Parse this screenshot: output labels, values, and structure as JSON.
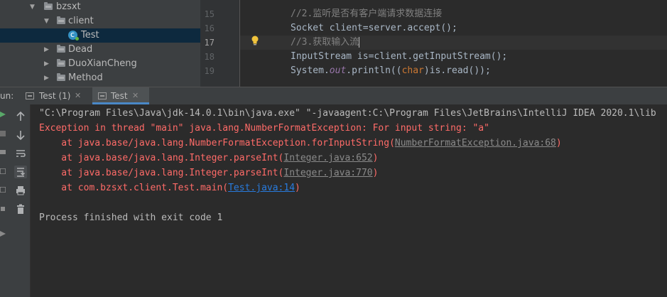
{
  "project_tree": {
    "items": [
      {
        "label": "bzsxt",
        "type": "package",
        "expanded": true
      },
      {
        "label": "client",
        "type": "package",
        "expanded": true
      },
      {
        "label": "Test",
        "type": "class",
        "selected": true
      },
      {
        "label": "Dead",
        "type": "package",
        "expanded": false
      },
      {
        "label": "DuoXianCheng",
        "type": "package",
        "expanded": false
      },
      {
        "label": "Method",
        "type": "package",
        "expanded": false
      }
    ]
  },
  "editor": {
    "line_numbers": [
      "15",
      "16",
      "17",
      "18",
      "19"
    ],
    "current_line": "17",
    "lines": {
      "l15": "//2.监听是否有客户端请求数据连接",
      "l16": "Socket client=server.accept();",
      "l17": "//3.获取输入流",
      "l18": "InputStream is=client.getInputStream();",
      "l19a": "System.",
      "l19b": "out",
      "l19c": ".println((",
      "l19d": "char",
      "l19e": ")is.read());"
    }
  },
  "run_window": {
    "label": "un:",
    "tabs": [
      {
        "label": "Test (1)",
        "active": false
      },
      {
        "label": "Test",
        "active": true
      }
    ],
    "toolbar_icons": [
      "run-icon",
      "up-arrow-icon",
      "down-arrow-icon",
      "soft-wrap-icon",
      "scroll-to-end-icon",
      "print-icon",
      "trash-icon"
    ]
  },
  "console": {
    "command": "\"C:\\Program Files\\Java\\jdk-14.0.1\\bin\\java.exe\" \"-javaagent:C:\\Program Files\\JetBrains\\IntelliJ IDEA 2020.1\\lib",
    "exception": "Exception in thread \"main\" java.lang.NumberFormatException: For input string: \"a\"",
    "stack": [
      {
        "prefix": "    at java.base/java.lang.NumberFormatException.forInputString(",
        "link": "NumberFormatException.java:68",
        "suffix": ")",
        "link_style": "library"
      },
      {
        "prefix": "    at java.base/java.lang.Integer.parseInt(",
        "link": "Integer.java:652",
        "suffix": ")",
        "link_style": "library"
      },
      {
        "prefix": "    at java.base/java.lang.Integer.parseInt(",
        "link": "Integer.java:770",
        "suffix": ")",
        "link_style": "library"
      },
      {
        "prefix": "    at com.bzsxt.client.Test.main(",
        "link": "Test.java:14",
        "suffix": ")",
        "link_style": "project"
      }
    ],
    "exit_message": "Process finished with exit code 1"
  },
  "colors": {
    "error": "#ff6b68",
    "link": "#287bde",
    "selection": "#0d293e",
    "accent": "#4a88c7"
  }
}
